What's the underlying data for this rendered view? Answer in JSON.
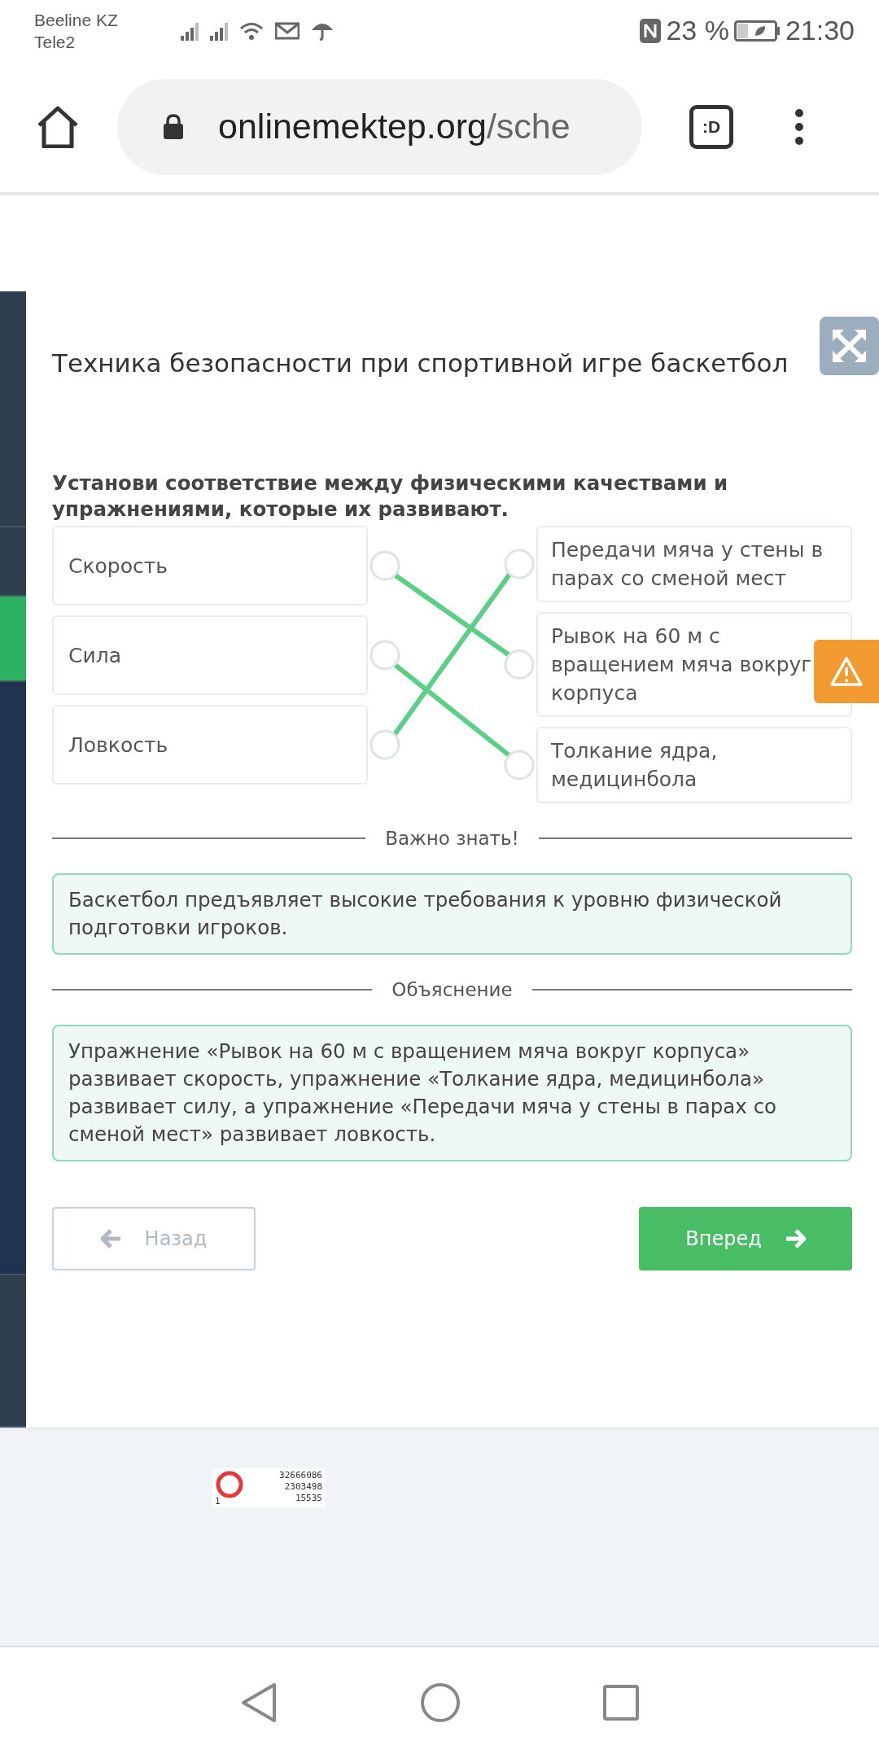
{
  "status_bar": {
    "carriers": [
      "Beeline KZ",
      "Tele2"
    ],
    "battery": "23 %",
    "time": "21:30"
  },
  "browser": {
    "url_host": "onlinemektep.org",
    "url_path": "/sche",
    "tab_switcher": ":D"
  },
  "sidebar": {
    "items": [
      {
        "selected": false
      },
      {
        "selected": false
      },
      {
        "selected": true
      },
      {
        "selected": false
      },
      {
        "selected": false
      }
    ]
  },
  "lesson": {
    "title": "Техника безопасности при спортивной игре баскетбол",
    "question": "Установи соответствие между физическими качествами и упражнениями, которые их развивают.",
    "left": [
      {
        "text": "Скорость",
        "links": [
          false,
          true,
          false
        ]
      },
      {
        "text": "Сила",
        "links": [
          false,
          false,
          true
        ]
      },
      {
        "text": "Ловкость",
        "links": [
          true,
          false,
          false
        ]
      }
    ],
    "right": [
      {
        "text": "Передачи мяча у стены в парах со сменой мест"
      },
      {
        "text": "Рывок на 60 м с вращением мяча вокруг корпуса"
      },
      {
        "text": "Толкание ядра, медицинбола"
      }
    ],
    "sections": [
      {
        "heading": "Важно знать!",
        "text": "Баскетбол предъявляет высокие требования к уровню физической подготовки игроков."
      },
      {
        "heading": "Объяснение",
        "text": "Упражнение «Рывок на 60 м с вращением мяча вокруг корпуса» развивает скорость, упражнение «Толкание ядра, медицинбола» развивает силу, а упражнение «Передачи мяча у стены в парах со сменой мест» развивает ловкость."
      }
    ],
    "buttons": [
      {
        "label": "Назад",
        "disabled": true
      },
      {
        "label": "Вперед",
        "disabled": false
      }
    ]
  },
  "counter": {
    "rows": [
      "32666086",
      "2303498",
      "15535"
    ],
    "corner": "1"
  }
}
